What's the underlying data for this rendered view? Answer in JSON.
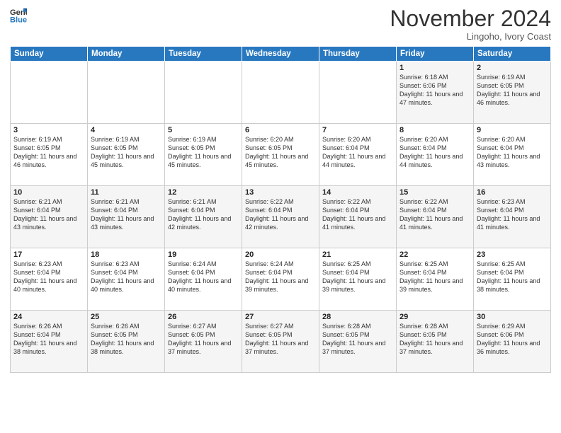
{
  "header": {
    "logo_line1": "General",
    "logo_line2": "Blue",
    "month": "November 2024",
    "location": "Lingoho, Ivory Coast"
  },
  "days_of_week": [
    "Sunday",
    "Monday",
    "Tuesday",
    "Wednesday",
    "Thursday",
    "Friday",
    "Saturday"
  ],
  "weeks": [
    [
      {
        "day": "",
        "info": ""
      },
      {
        "day": "",
        "info": ""
      },
      {
        "day": "",
        "info": ""
      },
      {
        "day": "",
        "info": ""
      },
      {
        "day": "",
        "info": ""
      },
      {
        "day": "1",
        "info": "Sunrise: 6:18 AM\nSunset: 6:06 PM\nDaylight: 11 hours and 47 minutes."
      },
      {
        "day": "2",
        "info": "Sunrise: 6:19 AM\nSunset: 6:05 PM\nDaylight: 11 hours and 46 minutes."
      }
    ],
    [
      {
        "day": "3",
        "info": "Sunrise: 6:19 AM\nSunset: 6:05 PM\nDaylight: 11 hours and 46 minutes."
      },
      {
        "day": "4",
        "info": "Sunrise: 6:19 AM\nSunset: 6:05 PM\nDaylight: 11 hours and 45 minutes."
      },
      {
        "day": "5",
        "info": "Sunrise: 6:19 AM\nSunset: 6:05 PM\nDaylight: 11 hours and 45 minutes."
      },
      {
        "day": "6",
        "info": "Sunrise: 6:20 AM\nSunset: 6:05 PM\nDaylight: 11 hours and 45 minutes."
      },
      {
        "day": "7",
        "info": "Sunrise: 6:20 AM\nSunset: 6:04 PM\nDaylight: 11 hours and 44 minutes."
      },
      {
        "day": "8",
        "info": "Sunrise: 6:20 AM\nSunset: 6:04 PM\nDaylight: 11 hours and 44 minutes."
      },
      {
        "day": "9",
        "info": "Sunrise: 6:20 AM\nSunset: 6:04 PM\nDaylight: 11 hours and 43 minutes."
      }
    ],
    [
      {
        "day": "10",
        "info": "Sunrise: 6:21 AM\nSunset: 6:04 PM\nDaylight: 11 hours and 43 minutes."
      },
      {
        "day": "11",
        "info": "Sunrise: 6:21 AM\nSunset: 6:04 PM\nDaylight: 11 hours and 43 minutes."
      },
      {
        "day": "12",
        "info": "Sunrise: 6:21 AM\nSunset: 6:04 PM\nDaylight: 11 hours and 42 minutes."
      },
      {
        "day": "13",
        "info": "Sunrise: 6:22 AM\nSunset: 6:04 PM\nDaylight: 11 hours and 42 minutes."
      },
      {
        "day": "14",
        "info": "Sunrise: 6:22 AM\nSunset: 6:04 PM\nDaylight: 11 hours and 41 minutes."
      },
      {
        "day": "15",
        "info": "Sunrise: 6:22 AM\nSunset: 6:04 PM\nDaylight: 11 hours and 41 minutes."
      },
      {
        "day": "16",
        "info": "Sunrise: 6:23 AM\nSunset: 6:04 PM\nDaylight: 11 hours and 41 minutes."
      }
    ],
    [
      {
        "day": "17",
        "info": "Sunrise: 6:23 AM\nSunset: 6:04 PM\nDaylight: 11 hours and 40 minutes."
      },
      {
        "day": "18",
        "info": "Sunrise: 6:23 AM\nSunset: 6:04 PM\nDaylight: 11 hours and 40 minutes."
      },
      {
        "day": "19",
        "info": "Sunrise: 6:24 AM\nSunset: 6:04 PM\nDaylight: 11 hours and 40 minutes."
      },
      {
        "day": "20",
        "info": "Sunrise: 6:24 AM\nSunset: 6:04 PM\nDaylight: 11 hours and 39 minutes."
      },
      {
        "day": "21",
        "info": "Sunrise: 6:25 AM\nSunset: 6:04 PM\nDaylight: 11 hours and 39 minutes."
      },
      {
        "day": "22",
        "info": "Sunrise: 6:25 AM\nSunset: 6:04 PM\nDaylight: 11 hours and 39 minutes."
      },
      {
        "day": "23",
        "info": "Sunrise: 6:25 AM\nSunset: 6:04 PM\nDaylight: 11 hours and 38 minutes."
      }
    ],
    [
      {
        "day": "24",
        "info": "Sunrise: 6:26 AM\nSunset: 6:04 PM\nDaylight: 11 hours and 38 minutes."
      },
      {
        "day": "25",
        "info": "Sunrise: 6:26 AM\nSunset: 6:05 PM\nDaylight: 11 hours and 38 minutes."
      },
      {
        "day": "26",
        "info": "Sunrise: 6:27 AM\nSunset: 6:05 PM\nDaylight: 11 hours and 37 minutes."
      },
      {
        "day": "27",
        "info": "Sunrise: 6:27 AM\nSunset: 6:05 PM\nDaylight: 11 hours and 37 minutes."
      },
      {
        "day": "28",
        "info": "Sunrise: 6:28 AM\nSunset: 6:05 PM\nDaylight: 11 hours and 37 minutes."
      },
      {
        "day": "29",
        "info": "Sunrise: 6:28 AM\nSunset: 6:05 PM\nDaylight: 11 hours and 37 minutes."
      },
      {
        "day": "30",
        "info": "Sunrise: 6:29 AM\nSunset: 6:06 PM\nDaylight: 11 hours and 36 minutes."
      }
    ]
  ]
}
